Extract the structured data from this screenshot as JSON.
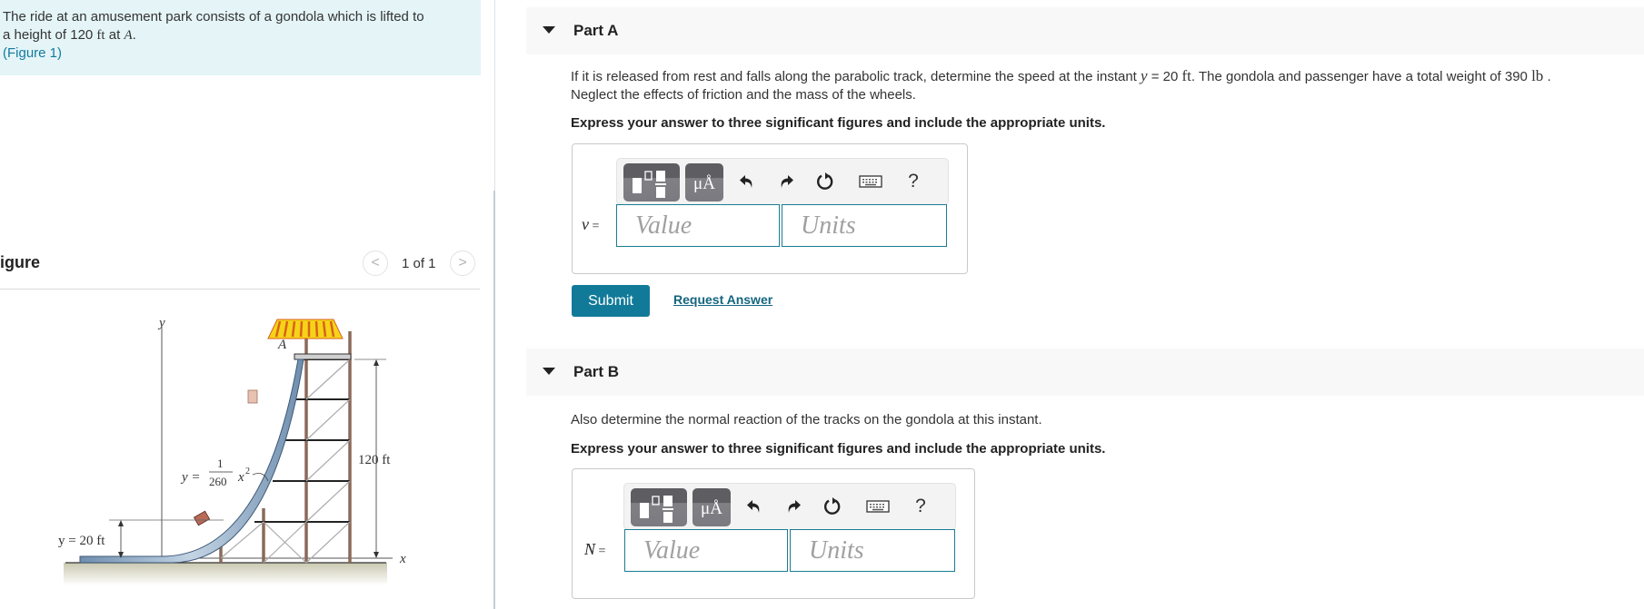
{
  "intro": {
    "line1": "The ride at an amusement park consists of a gondola which is lifted to",
    "line2_prefix": "a height of 120 ",
    "line2_unit": "ft",
    "line2_mid": " at ",
    "line2_point": "A",
    "line2_end": ".",
    "figure_link_open": "(",
    "figure_link_text": "Figure 1",
    "figure_link_close": ")"
  },
  "figure_panel": {
    "title": "igure",
    "counter": "1 of 1",
    "prev_icon": "chevron-left-icon",
    "next_icon": "chevron-right-icon",
    "prev_glyph": "<",
    "next_glyph": ">"
  },
  "figure": {
    "y_axis_label": "y",
    "x_axis_label": "x",
    "point_label": "A",
    "height_label": "120 ft",
    "y20_label": "y = 20 ft",
    "eq_lhs": "y =",
    "eq_num": "1",
    "eq_den": "260",
    "eq_var": "x",
    "eq_exp": "2"
  },
  "partA": {
    "title": "Part A",
    "question_l1_a": "If it is released from rest and falls along the parabolic track, determine the speed at the instant ",
    "question_l1_var": "y",
    "question_l1_b": " = 20 ",
    "question_l1_unit": "ft",
    "question_l1_c": ". The gondola and passenger have a total weight of 390 ",
    "question_l1_unit2": "lb",
    "question_l1_d": " .",
    "question_l2": "Neglect the effects of friction and the mass of the wheels.",
    "instruction": "Express your answer to three significant figures and include the appropriate units.",
    "variable": "v",
    "equals": " =",
    "value_placeholder": "Value",
    "units_placeholder": "Units",
    "value": "",
    "units": ""
  },
  "partB": {
    "title": "Part B",
    "question": "Also determine the normal reaction of the tracks on the gondola at this instant.",
    "instruction": "Express your answer to three significant figures and include the appropriate units.",
    "variable": "N",
    "equals": " =",
    "value_placeholder": "Value",
    "units_placeholder": "Units",
    "value": "",
    "units": ""
  },
  "toolbar": {
    "units_label": "μÅ",
    "help_label": "?",
    "icons": [
      "templates-icon",
      "units-icon",
      "undo-icon",
      "redo-icon",
      "reset-icon",
      "keyboard-icon",
      "help-icon"
    ]
  },
  "actions": {
    "submit_label": "Submit",
    "request_answer_label": "Request Answer"
  },
  "colors": {
    "intro_bg": "#e4f4f7",
    "accent": "#117a99",
    "link": "#157a9e",
    "input_border": "#1b7c91",
    "header_bg": "#f8f8f8"
  }
}
